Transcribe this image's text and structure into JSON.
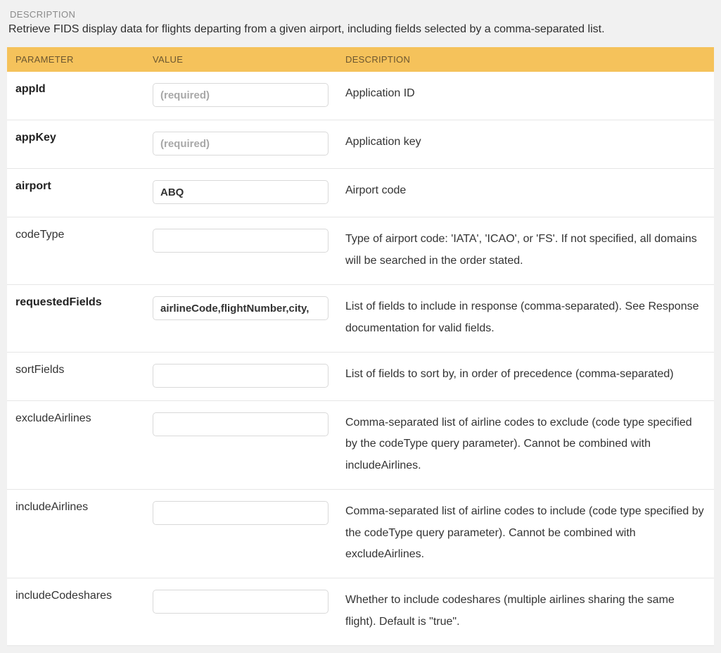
{
  "section": {
    "label": "DESCRIPTION",
    "text": "Retrieve FIDS display data for flights departing from a given airport, including fields selected by a comma-separated list."
  },
  "table": {
    "headers": {
      "parameter": "PARAMETER",
      "value": "VALUE",
      "description": "DESCRIPTION"
    }
  },
  "params": {
    "appId": {
      "name": "appId",
      "placeholder": "(required)",
      "value": "",
      "desc": "Application ID"
    },
    "appKey": {
      "name": "appKey",
      "placeholder": "(required)",
      "value": "",
      "desc": "Application key"
    },
    "airport": {
      "name": "airport",
      "placeholder": "",
      "value": "ABQ",
      "desc": "Airport code"
    },
    "codeType": {
      "name": "codeType",
      "placeholder": "",
      "value": "",
      "desc": "Type of airport code: 'IATA', 'ICAO', or 'FS'. If not specified, all domains will be searched in the order stated."
    },
    "requestedFields": {
      "name": "requestedFields",
      "placeholder": "",
      "value": "airlineCode,flightNumber,city,",
      "desc": "List of fields to include in response (comma-separated). See Response documentation for valid fields."
    },
    "sortFields": {
      "name": "sortFields",
      "placeholder": "",
      "value": "",
      "desc": "List of fields to sort by, in order of precedence (comma-separated)"
    },
    "excludeAirlines": {
      "name": "excludeAirlines",
      "placeholder": "",
      "value": "",
      "desc": "Comma-separated list of airline codes to exclude (code type specified by the codeType query parameter). Cannot be combined with includeAirlines."
    },
    "includeAirlines": {
      "name": "includeAirlines",
      "placeholder": "",
      "value": "",
      "desc": "Comma-separated list of airline codes to include (code type specified by the codeType query parameter). Cannot be combined with excludeAirlines."
    },
    "includeCodeshares": {
      "name": "includeCodeshares",
      "placeholder": "",
      "value": "",
      "desc": "Whether to include codeshares (multiple airlines sharing the same flight). Default is \"true\"."
    }
  }
}
